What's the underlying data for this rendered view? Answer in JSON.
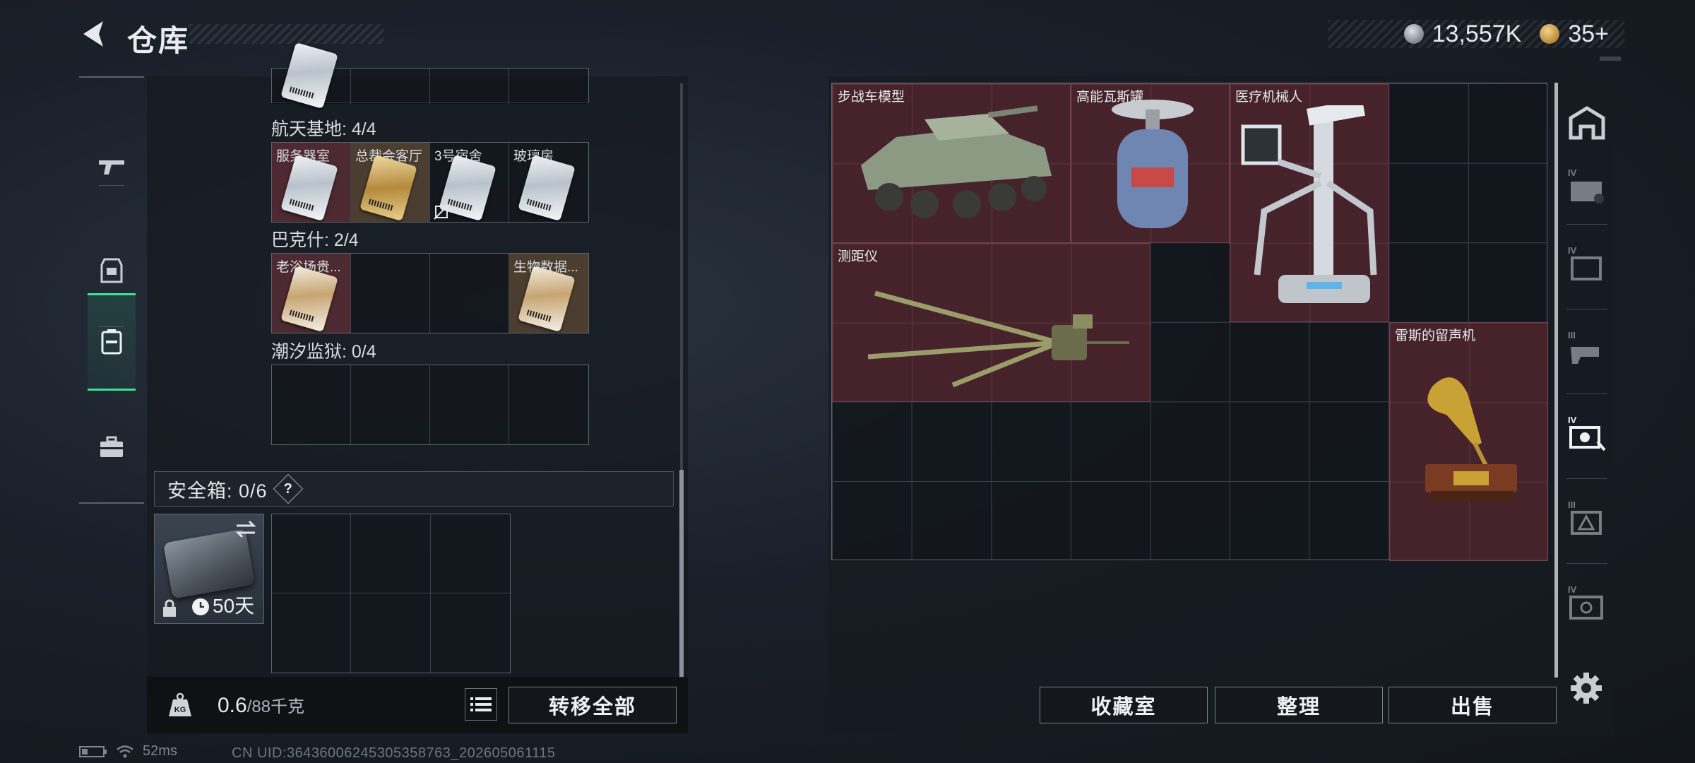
{
  "header": {
    "title": "仓库",
    "currency": [
      {
        "icon": "silver-coin-icon",
        "value": "13,557K"
      },
      {
        "icon": "gold-coin-icon",
        "value": "35+"
      }
    ]
  },
  "left_nav": {
    "items": [
      {
        "icon": "gun-icon",
        "active": false
      },
      {
        "icon": "armor-icon",
        "active": false
      },
      {
        "icon": "backpack-icon",
        "active": true
      },
      {
        "icon": "toolbox-icon",
        "active": false
      }
    ]
  },
  "key_sections": [
    {
      "title": "航天基地: 4/4",
      "slots": [
        "服务器室",
        "总裁会客厅",
        "3号宿舍",
        "玻璃房"
      ]
    },
    {
      "title": "巴克什: 2/4",
      "slots": [
        "老浴场贵...",
        "",
        "",
        "生物数据..."
      ]
    },
    {
      "title": "潮汐监狱: 0/4",
      "slots": [
        "",
        "",
        "",
        ""
      ]
    }
  ],
  "safe": {
    "title": "安全箱:  0/6",
    "help": "?",
    "days": "50天"
  },
  "weight": {
    "current": "0.6",
    "max": "/88千克"
  },
  "buttons": {
    "transfer_all": "转移全部",
    "collection": "收藏室",
    "organize": "整理",
    "sell": "出售"
  },
  "stash_items": [
    {
      "name": "步战车模型"
    },
    {
      "name": "高能瓦斯罐"
    },
    {
      "name": "医疗机械人"
    },
    {
      "name": "测距仪"
    },
    {
      "name": "雷斯的留声机"
    }
  ],
  "status": {
    "ping": "52ms",
    "uid": "CN UID:364360062453053587​63_202605061115"
  },
  "colors": {
    "accent": "#3ae39a",
    "item_bg": "#52262e"
  }
}
